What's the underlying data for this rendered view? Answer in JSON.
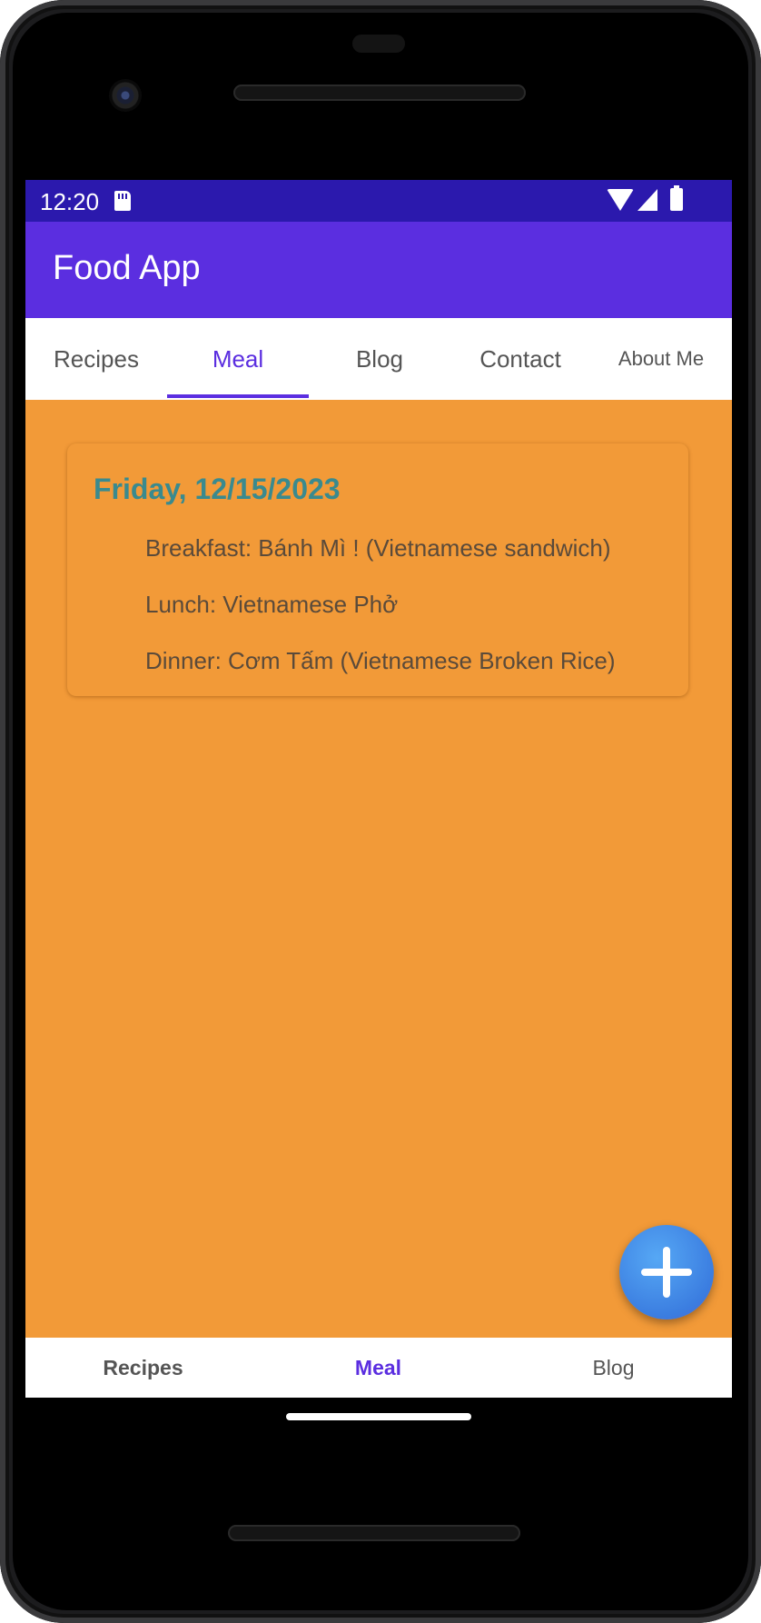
{
  "status_bar": {
    "time": "12:20"
  },
  "app_bar": {
    "title": "Food App"
  },
  "tabs": [
    {
      "label": "Recipes"
    },
    {
      "label": "Meal"
    },
    {
      "label": "Blog"
    },
    {
      "label": "Contact"
    },
    {
      "label": "About Me"
    }
  ],
  "active_tab": "Meal",
  "meal_card": {
    "date": "Friday, 12/15/2023",
    "breakfast": "Breakfast: Bánh Mì ! (Vietnamese sandwich)",
    "lunch": "Lunch: Vietnamese Phở",
    "dinner": "Dinner: Cơm Tấm (Vietnamese Broken Rice)"
  },
  "fab": {
    "icon": "plus-icon"
  },
  "bottom_nav": [
    {
      "label": "Recipes"
    },
    {
      "label": "Meal"
    },
    {
      "label": "Blog"
    }
  ],
  "colors": {
    "status_bar": "#2b19ad",
    "app_bar": "#5b2ee0",
    "background": "#f29a38",
    "date_text": "#3a8a8e",
    "accent": "#5b2ee0"
  }
}
